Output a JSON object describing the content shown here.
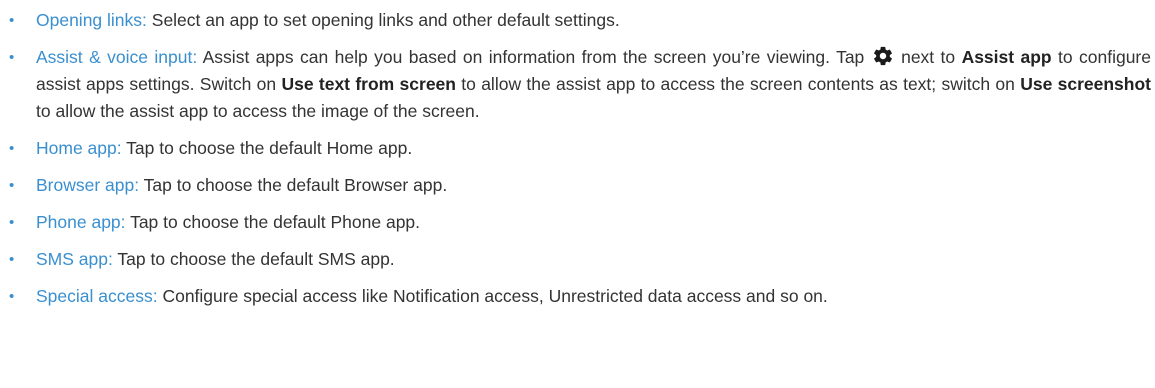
{
  "items": [
    {
      "term": "Opening links:",
      "text": " Select an app to set opening links and other default settings."
    },
    {
      "term": "Assist & voice input:",
      "text_a": " Assist apps can help you based on information from the screen you’re viewing. Tap ",
      "icon": "gear-icon",
      "text_b": " next to ",
      "bold_a": "Assist app",
      "text_c": " to configure assist apps settings. Switch on ",
      "bold_b": "Use text from screen",
      "text_d": " to allow the assist app to access the screen contents as text; switch on ",
      "bold_c": "Use screenshot",
      "text_e": " to allow the assist app to access the image of the screen."
    },
    {
      "term": "Home app:",
      "text": " Tap to choose the default Home app."
    },
    {
      "term": "Browser app:",
      "text": " Tap to choose the default Browser app."
    },
    {
      "term": "Phone app:",
      "text": " Tap to choose the default Phone app."
    },
    {
      "term": "SMS app:",
      "text": " Tap to choose the default SMS app."
    },
    {
      "term": "Special access:",
      "text": " Configure special access like Notification access, Unrestricted data access and so on."
    }
  ],
  "bullet_char": "•",
  "colors": {
    "term": "#3a8fcf",
    "text": "#333333"
  }
}
